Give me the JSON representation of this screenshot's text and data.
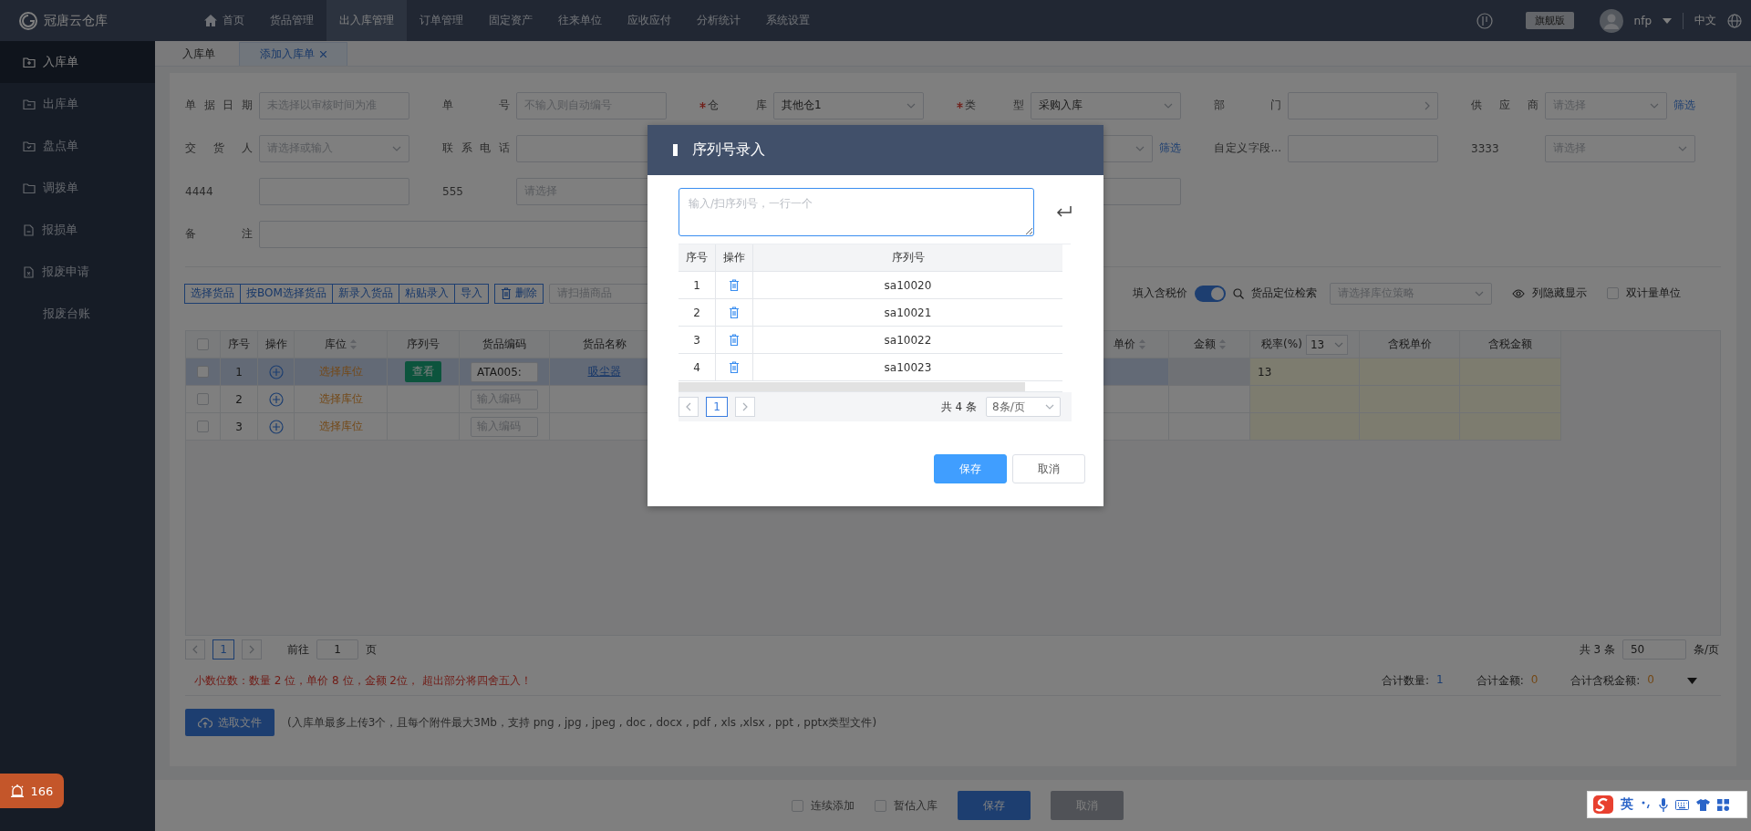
{
  "top_bar": {
    "brand": "冠唐云仓库",
    "nav": [
      {
        "label": "首页",
        "selected": false
      },
      {
        "label": "货品管理",
        "selected": false
      },
      {
        "label": "出入库管理",
        "selected": true
      },
      {
        "label": "订单管理",
        "selected": false
      },
      {
        "label": "固定资产",
        "selected": false
      },
      {
        "label": "往来单位",
        "selected": false
      },
      {
        "label": "应收应付",
        "selected": false
      },
      {
        "label": "分析统计",
        "selected": false
      },
      {
        "label": "系统设置",
        "selected": false
      }
    ],
    "edition": "旗舰版",
    "user": "nfp",
    "language": "中文"
  },
  "sidebar": {
    "items": [
      {
        "label": "入库单",
        "selected": true
      },
      {
        "label": "出库单",
        "selected": false
      },
      {
        "label": "盘点单",
        "selected": false
      },
      {
        "label": "调拨单",
        "selected": false
      },
      {
        "label": "报损单",
        "selected": false
      },
      {
        "label": "报废申请",
        "selected": false
      },
      {
        "label": "报废台账",
        "selected": false
      }
    ],
    "alert_badge": "166"
  },
  "tabs": [
    {
      "label": "入库单",
      "selected": false,
      "closable": false
    },
    {
      "label": "添加入库单",
      "selected": true,
      "closable": true
    }
  ],
  "form": {
    "rows": [
      [
        {
          "label": "单据日期",
          "required": false,
          "kind": "text",
          "placeholder": "未选择以审核时间为准"
        },
        {
          "label": "单号",
          "required": false,
          "kind": "text",
          "placeholder": "不输入则自动编号"
        },
        {
          "label": "仓库",
          "required": true,
          "kind": "select",
          "value": "其他仓1"
        },
        {
          "label": "类型",
          "required": true,
          "kind": "select",
          "value": "采购入库"
        },
        {
          "label": "部门",
          "required": false,
          "kind": "cascader"
        },
        {
          "label": "供应商",
          "required": false,
          "kind": "select",
          "placeholder": "请选择",
          "link": "筛选"
        }
      ],
      [
        {
          "label": "交货人",
          "required": false,
          "kind": "select",
          "placeholder": "请选择或输入"
        },
        {
          "label": "联系电话",
          "required": false,
          "kind": "text"
        },
        "",
        {
          "required": false,
          "kind": "select",
          "link": "筛选"
        },
        {
          "label": "自定义字段...",
          "required": false,
          "kind": "text"
        },
        {
          "label": "3333",
          "required": false,
          "kind": "select",
          "placeholder": "请选择"
        }
      ],
      [
        {
          "label": "4444",
          "required": false,
          "kind": "text"
        },
        {
          "label": "555",
          "required": false,
          "kind": "text",
          "placeholder": "请选择"
        },
        "",
        {
          "required": false,
          "kind": "text"
        }
      ],
      [
        {
          "label": "备注",
          "required": false,
          "kind": "textarea"
        }
      ]
    ]
  },
  "toolbar": {
    "buttons": [
      "选择货品",
      "按BOM选择货品",
      "新录入货品",
      "粘贴录入",
      "导入"
    ],
    "delete_button": "删除",
    "scan_field": {
      "placeholder": "请扫描商品"
    },
    "tax_toggle": {
      "label": "填入含税价",
      "on": true
    },
    "locate_search": "货品定位检索",
    "location_strategy": {
      "placeholder": "请选择库位策略"
    },
    "column_visibility": "列隐藏显示",
    "dual_unit": {
      "label": "双计量单位",
      "checked": false
    }
  },
  "table": {
    "all_checked": false,
    "columns_left": [
      {
        "label": "序号",
        "sortable": false
      },
      {
        "label": "操作",
        "sortable": false
      },
      {
        "label": "库位",
        "sortable": true
      },
      {
        "label": "序列号",
        "sortable": false
      },
      {
        "label": "货品编码",
        "sortable": false
      },
      {
        "label": "货品名称",
        "sortable": false
      }
    ],
    "columns_right": [
      {
        "label": "单价",
        "sortable": true
      },
      {
        "label": "金额",
        "sortable": true
      },
      {
        "label": "税率(%)",
        "sortable": false,
        "select": "13"
      },
      {
        "label": "含税单价",
        "sortable": false
      },
      {
        "label": "含税金额",
        "sortable": false
      }
    ],
    "rows": [
      {
        "selected": true,
        "checked": false,
        "no": "1",
        "location": "选择库位",
        "serial": "查看",
        "code": "ATA005:",
        "name": "吸尘器",
        "tax_rate": "13"
      },
      {
        "selected": false,
        "checked": false,
        "no": "2",
        "location": "选择库位",
        "code_placeholder": "输入编码"
      },
      {
        "selected": false,
        "checked": false,
        "no": "3",
        "location": "选择库位",
        "code_placeholder": "输入编码"
      }
    ]
  },
  "pagination": {
    "page": "1",
    "goto_label": "前往",
    "goto_value": "1",
    "page_suffix": "页",
    "total": "共 3 条",
    "page_size": "50",
    "page_size_suffix": "条/页"
  },
  "summary": {
    "notice": "小数位数：数量 2 位，单价 8 位，金额 2位， 超出部分将四舍五入！",
    "totals": [
      {
        "label": "合计数量:",
        "value": "1"
      },
      {
        "label": "合计金额:",
        "value": "0"
      },
      {
        "label": "合计含税金额:",
        "value": "0"
      }
    ]
  },
  "attachments": {
    "button": "选取文件",
    "hint": "(入库单最多上传3个，且每个附件最大3Mb，支持 png , jpg , jpeg , doc , docx , pdf , xls ,xlsx , ppt , pptx类型文件)"
  },
  "footer": {
    "options": [
      {
        "label": "连续添加",
        "checked": false
      },
      {
        "label": "暂估入库",
        "checked": false
      }
    ],
    "save": "保存",
    "cancel": {
      "label": "取消",
      "disabled": true
    }
  },
  "modal": {
    "title": "序列号录入",
    "input": {
      "placeholder": "输入/扫序列号，一行一个"
    },
    "columns": [
      "序号",
      "操作",
      "序列号"
    ],
    "rows": [
      {
        "no": "1",
        "serial": "sa10020"
      },
      {
        "no": "2",
        "serial": "sa10021"
      },
      {
        "no": "3",
        "serial": "sa10022"
      },
      {
        "no": "4",
        "serial": "sa10023"
      }
    ],
    "pagination": {
      "page": "1",
      "total": "共 4 条",
      "page_size": "8条/页"
    },
    "save": "保存",
    "cancel": "取消"
  },
  "ime_bar": {
    "mode": "英"
  }
}
